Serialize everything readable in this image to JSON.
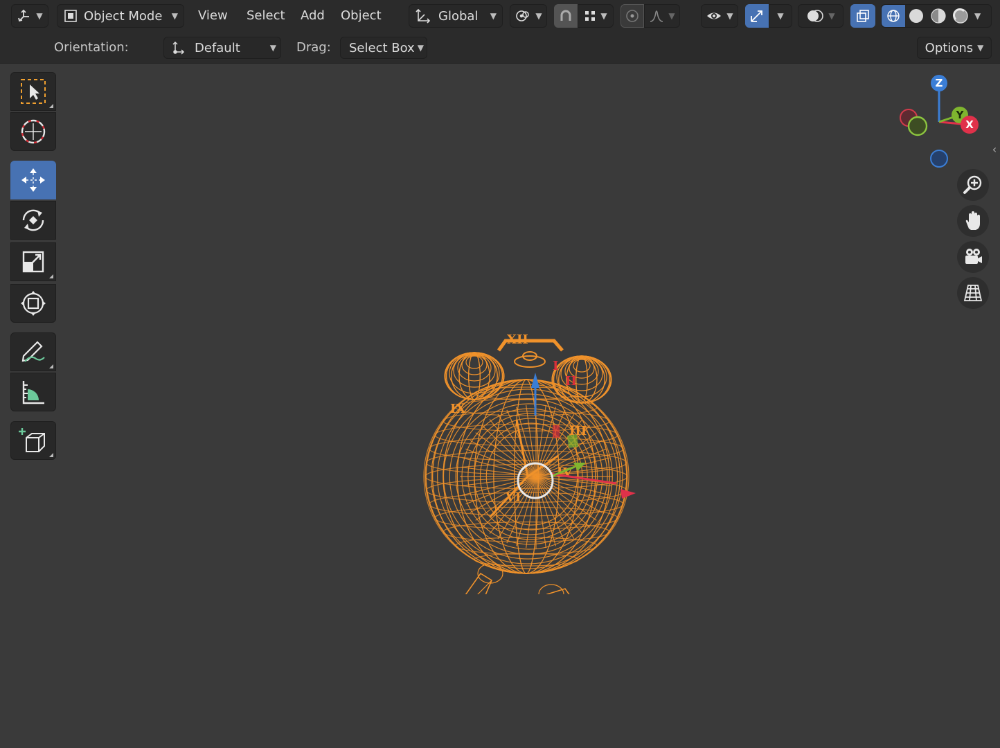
{
  "header": {
    "editor_type_icon": "view3d-editor-icon",
    "mode": {
      "label": "Object Mode",
      "icon": "object-mode-icon"
    },
    "menus": [
      "View",
      "Select",
      "Add",
      "Object"
    ],
    "transform_orientation": {
      "label": "Global",
      "icon": "global-orientation-icon"
    },
    "pivot_icon": "pivot-point-icon",
    "snap_icon": "magnet-icon",
    "snap_target_icon": "snap-increment-icon",
    "proportional_icon": "proportional-edit-icon",
    "falloff_icon": "falloff-curve-icon",
    "visibility_icon": "eye-icon",
    "gizmo_icon": "gizmo-icon",
    "overlay_icon": "overlay-icon",
    "xray_icon": "xray-icon",
    "shading": [
      "wireframe-shading-icon",
      "solid-shading-icon",
      "material-shading-icon",
      "rendered-shading-icon"
    ]
  },
  "tool_settings": {
    "orientation_label": "Orientation:",
    "orientation_value": "Default",
    "drag_label": "Drag:",
    "drag_value": "Select Box",
    "options_label": "Options"
  },
  "toolbar": {
    "tools": [
      "select-box-icon",
      "cursor-icon",
      "move-icon",
      "rotate-icon",
      "scale-icon",
      "transform-icon",
      "annotate-icon",
      "measure-icon",
      "add-cube-icon"
    ],
    "active_tool": "move-icon"
  },
  "navigation": {
    "axes": [
      "X",
      "Y",
      "Z"
    ],
    "buttons": [
      "zoom-icon",
      "pan-hand-icon",
      "camera-view-icon",
      "ortho-grid-icon"
    ]
  },
  "scene": {
    "object": "alarm-clock-wireframe",
    "selection_color": "#f0922b",
    "numerals": [
      "XII",
      "III",
      "VI",
      "IX",
      "IV",
      "II",
      "I"
    ]
  },
  "colors": {
    "accent": "#4772b3",
    "x_axis": "#e0314a",
    "y_axis": "#7fb52f",
    "z_axis": "#3b7ed6"
  }
}
